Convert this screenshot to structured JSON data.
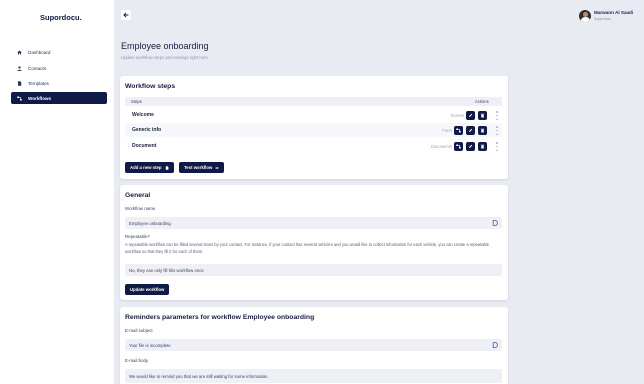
{
  "app": {
    "logo": "Supordocu."
  },
  "sidebar": {
    "items": [
      {
        "label": "Dashboard",
        "icon": "home-icon",
        "active": false
      },
      {
        "label": "Contacts",
        "icon": "user-icon",
        "active": false
      },
      {
        "label": "Templates",
        "icon": "document-icon",
        "active": false
      },
      {
        "label": "Workflows",
        "icon": "workflow-icon",
        "active": true
      }
    ]
  },
  "user": {
    "name": "Marwann Al Saadi",
    "company": "Superdocu"
  },
  "header": {
    "title": "Employee onboarding",
    "subtitle": "Update workflow steps and settings right here"
  },
  "workflow_steps": {
    "title": "Workflow steps",
    "columns": {
      "steps": "Steps",
      "actions": "Actions"
    },
    "rows": [
      {
        "name": "Welcome",
        "type": "Screen"
      },
      {
        "name": "Generic info",
        "type": "Form"
      },
      {
        "name": "Document",
        "type": "Documents"
      }
    ],
    "add_button": "Add a new step",
    "test_button": "Test workflow"
  },
  "general": {
    "title": "General",
    "name_label": "Workflow name",
    "name_value": "Employee onboarding",
    "repeatable_label": "Repeatable?",
    "repeatable_help": "A repeatable workflow can be filled several times by your contact. For instance, if your contact has several vehicles and you would like to collect information for each vehicle, you can create a repeatable workflow so that they fill it for each of them.",
    "repeatable_value": "No, they can only fill this workflow once",
    "update_button": "Update workflow"
  },
  "reminders": {
    "title": "Reminders parameters for workflow Employee onboarding",
    "subject_label": "E-mail subject",
    "subject_value": "Your file is incomplete",
    "body_label": "E-mail body",
    "body_value": "We would like to remind you that we are still waiting for some information."
  },
  "colors": {
    "primary": "#101a46",
    "background": "#e9ebf2",
    "card": "#ffffff"
  }
}
